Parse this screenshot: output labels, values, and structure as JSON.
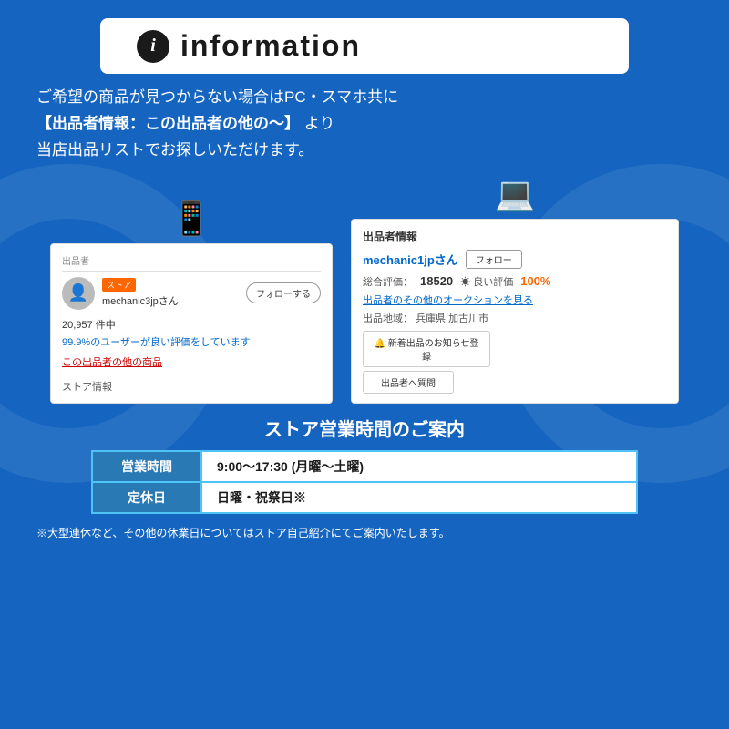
{
  "header": {
    "icon_label": "i",
    "title": "information"
  },
  "description": {
    "line1": "ご希望の商品が見つからない場合はPC・スマホ共に",
    "line2_bold": "【出品者情報：この出品者の他の〜】",
    "line2_suffix": " より",
    "line3": "当店出品リストでお探しいただけます。"
  },
  "mobile_screenshot": {
    "label": "出品者",
    "store_badge": "ストア",
    "seller_name": "mechanic3jpさん",
    "follow_btn": "フォローする",
    "count": "20,957 件中",
    "rating_text": "99.9%のユーザーが良い評価をしています",
    "link_text": "この出品者の他の商品",
    "store_info": "ストア情報"
  },
  "desktop_screenshot": {
    "title": "出品者情報",
    "seller_name": "mechanic1jpさん",
    "follow_btn": "フォロー",
    "rating_label": "総合評価：",
    "rating_num": "18520",
    "good_label": "☀ 良い評価",
    "good_pct": "100%",
    "auction_link": "出品者のその他のオークションを見る",
    "location_label": "出品地域：",
    "location": "兵庫県 加古川市",
    "notify_btn": "🔔 新着出品のお知らせ登録",
    "question_btn": "出品者へ質問"
  },
  "store_hours": {
    "title": "ストア営業時間のご案内",
    "rows": [
      {
        "label": "営業時間",
        "value": "9:00〜17:30 (月曜〜土曜)"
      },
      {
        "label": "定休日",
        "value": "日曜・祝祭日※"
      }
    ]
  },
  "footer": {
    "note": "※大型連休など、その他の休業日についてはストア自己紹介にてご案内いたします。"
  },
  "icons": {
    "smartphone": "📱",
    "laptop": "💻"
  }
}
